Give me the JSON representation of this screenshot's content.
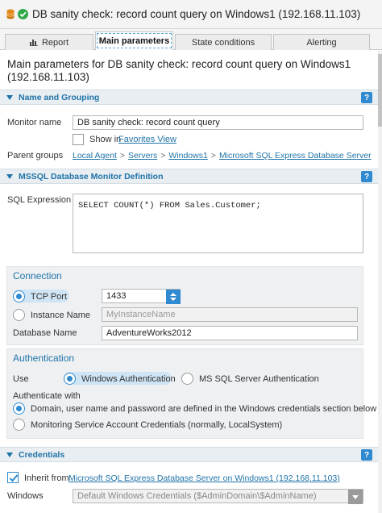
{
  "window": {
    "title": "DB sanity check: record count query on Windows1 (192.168.11.103)"
  },
  "tabs": [
    {
      "label": "Report"
    },
    {
      "label": "Main parameters"
    },
    {
      "label": "State conditions"
    },
    {
      "label": "Alerting"
    }
  ],
  "page_title": "Main parameters for DB sanity check: record count query on Windows1 (192.168.11.103)",
  "help_label": "?",
  "name_grouping": {
    "header": "Name and Grouping",
    "monitor_name_label": "Monitor name",
    "monitor_name_value": "DB sanity check: record count query",
    "show_in_label": "Show in",
    "favorites_link": "Favorites View",
    "parent_groups_label": "Parent groups",
    "crumbs": [
      "Local Agent",
      "Servers",
      "Windows1",
      "Microsoft SQL Express Database Server"
    ],
    "crumb_sep": ">"
  },
  "definition": {
    "header": "MSSQL Database Monitor Definition",
    "sql_label": "SQL Expression",
    "sql_value": "SELECT COUNT(*) FROM Sales.Customer;"
  },
  "connection": {
    "title": "Connection",
    "tcp_port_label": "TCP Port",
    "tcp_port_value": "1433",
    "instance_label": "Instance Name",
    "instance_placeholder": "MyInstanceName",
    "database_label": "Database Name",
    "database_value": "AdventureWorks2012"
  },
  "authentication": {
    "title": "Authentication",
    "use_label": "Use",
    "windows_auth": "Windows Authentication",
    "sql_auth": "MS SQL Server Authentication",
    "auth_with_label": "Authenticate with",
    "option_domain": "Domain, user name and password are defined in the Windows credentials section below",
    "option_service": "Monitoring Service Account Credentials (normally, LocalSystem)"
  },
  "credentials": {
    "header": "Credentials",
    "inherit_label": "Inherit from",
    "inherit_link": "Microsoft SQL Express Database Server on Windows1 (192.168.11.103)",
    "windows_label": "Windows",
    "windows_value": "Default Windows Credentials ($AdminDomain\\$AdminName)"
  },
  "colors": {
    "accent": "#2f8ad0",
    "link": "#1f73a8",
    "status_ok": "#2fa84a"
  },
  "icons": [
    "database-icon",
    "status-ok-icon",
    "report-icon",
    "collapse-arrow-icon",
    "help-icon",
    "spinner-icon",
    "checkmark-icon",
    "dropdown-arrow-icon"
  ]
}
